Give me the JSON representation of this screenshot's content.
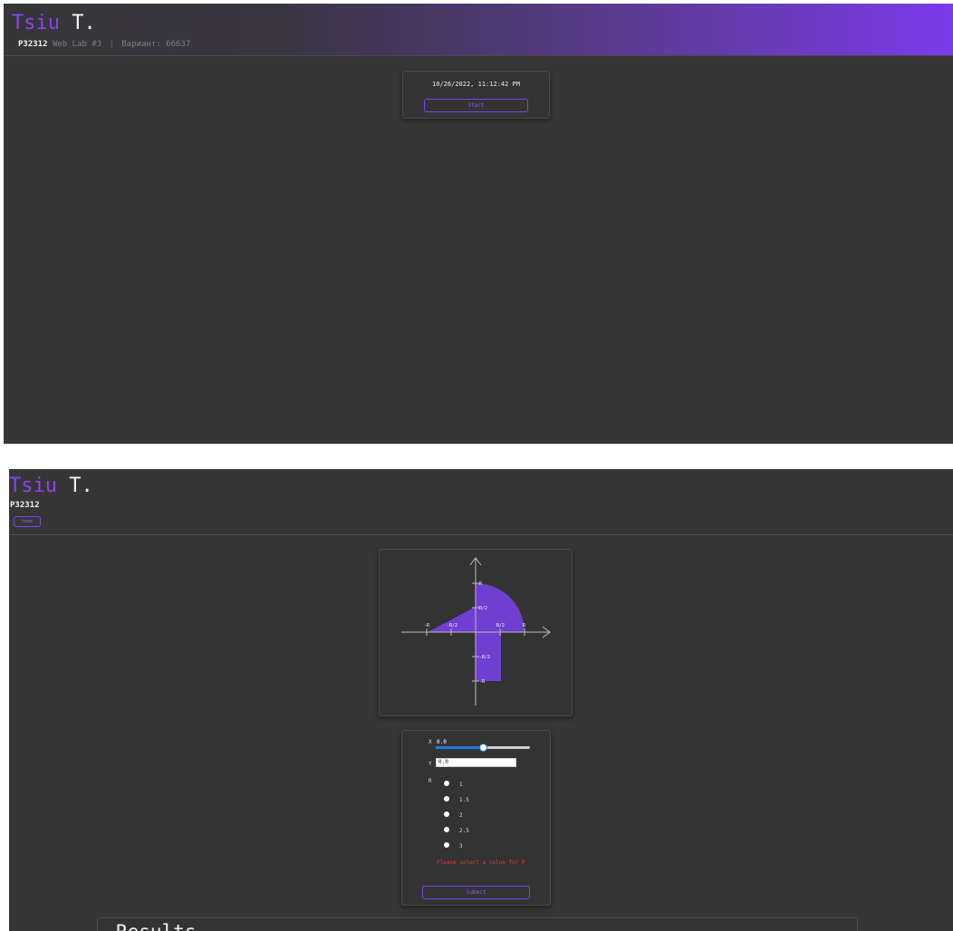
{
  "colors": {
    "accent": "#7b3bea",
    "background": "#363636",
    "error": "#d93b3b",
    "slider": "#1e7bd8"
  },
  "start_page": {
    "brand_first": "Tsiu",
    "brand_last": "T.",
    "group": "P32312",
    "lab": "Web Lab #3",
    "separator": "|",
    "variant": "Вариант: 66637",
    "clock": "10/26/2022, 11:12:42 PM",
    "start_label": "Start"
  },
  "main_page": {
    "brand_first": "Tsiu",
    "brand_last": "T.",
    "group": "P32312",
    "home_label": "home",
    "graph": {
      "labels": {
        "neg_r": "-R",
        "neg_half_r": "-R/2",
        "half_r": "R/2",
        "r": "R"
      }
    },
    "form": {
      "x_label": "X",
      "x_value": "0.0",
      "x_slider_fraction": 0.5,
      "y_label": "Y",
      "y_value": "0.0",
      "r_label": "R",
      "r_options": [
        "1",
        "1.5",
        "2",
        "2.5",
        "3"
      ],
      "error": "Please select a value for R",
      "submit_label": "Submit"
    },
    "results_title": "Results"
  }
}
